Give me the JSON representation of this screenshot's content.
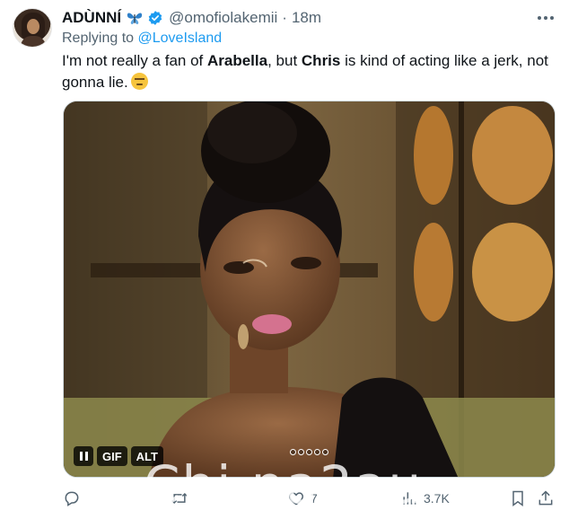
{
  "tweet": {
    "author_name": "ADÙNNÍ",
    "handle": "@omofiolakemii",
    "separator": "·",
    "time": "18m",
    "replying_prefix": "Replying to ",
    "replying_to": "@LoveIsland",
    "text_part1": "I'm not really a fan of ",
    "text_bold1": "Arabella",
    "text_part2": ", but ",
    "text_bold2": "Chris",
    "text_part3": " is kind of acting like a jerk, not gonna lie."
  },
  "media": {
    "gif_label": "GIF",
    "alt_label": "ALT"
  },
  "actions": {
    "like_count": "7",
    "views_count": "3.7K"
  },
  "icons": {
    "more": "more-icon",
    "reply": "reply-icon",
    "retweet": "retweet-icon",
    "like": "heart-icon",
    "views": "analytics-icon",
    "bookmark": "bookmark-icon",
    "share": "share-icon",
    "pause": "pause-icon",
    "verified": "verified-badge-icon",
    "emoji": "unamused-face-emoji"
  },
  "watermark": "Chi na2au",
  "colors": {
    "accent": "#1d9bf0",
    "secondary_text": "#536471",
    "primary_text": "#0f1419"
  }
}
